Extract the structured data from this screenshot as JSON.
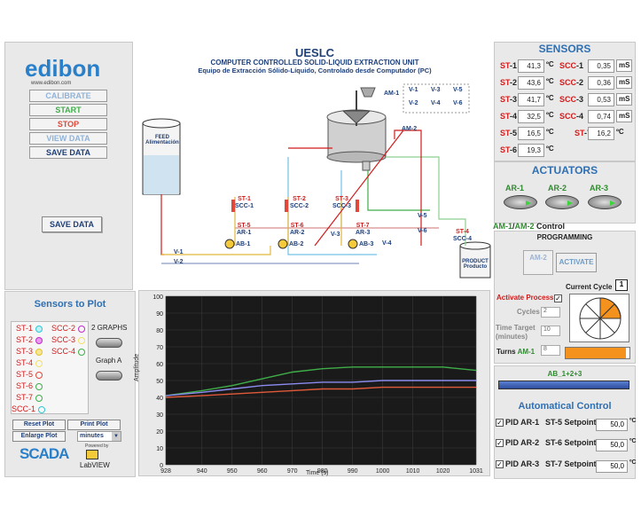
{
  "brand": {
    "logo": "edibon",
    "url": "www.edibon.com"
  },
  "left_buttons": {
    "calibrate": "CALIBRATE",
    "start": "START",
    "stop": "STOP",
    "view_data": "VIEW DATA",
    "save_data": "SAVE DATA",
    "save_data_2": "SAVE DATA"
  },
  "diagram": {
    "title": "UESLC",
    "subtitle": "COMPUTER CONTROLLED SOLID-LIQUID EXTRACTION UNIT",
    "subtitle2": "Equipo de Extracción Sólido-Líquido, Controlado desde Computador (PC)",
    "feed_tank": "FEED Alimentación",
    "product_tank": "PRODUCT Producto",
    "am1": "AM-1",
    "am2": "AM-2",
    "v1": "V-1",
    "v2": "V-2",
    "v3": "V-3",
    "v4": "V-4",
    "v5": "V-5",
    "v6": "V-6",
    "st1": "ST-1",
    "scc1": "SCC-1",
    "st2": "ST-2",
    "scc2": "SCC-2",
    "st3": "ST-3",
    "scc3": "SCC-3",
    "st4": "ST-4",
    "scc4": "SCC-4",
    "st5": "ST-5",
    "ar1": "AR-1",
    "st6": "ST-6",
    "ar2": "AR-2",
    "st7": "ST-7",
    "ar3": "AR-3",
    "ab1": "AB-1",
    "ab2": "AB-2",
    "ab3": "AB-3"
  },
  "sensors": {
    "title": "SENSORS",
    "st1": {
      "pre": "ST",
      "num": "-1",
      "value": "41,3",
      "unit": "ºC"
    },
    "st2": {
      "pre": "ST",
      "num": "-2",
      "value": "43,6",
      "unit": "ºC"
    },
    "st3": {
      "pre": "ST",
      "num": "-3",
      "value": "41,7",
      "unit": "ºC"
    },
    "st4": {
      "pre": "ST",
      "num": "-4",
      "value": "32,5",
      "unit": "ºC"
    },
    "st5": {
      "pre": "ST",
      "num": "-5",
      "value": "16,5",
      "unit": "ºC"
    },
    "st6": {
      "pre": "ST",
      "num": "-6",
      "value": "19,3",
      "unit": "ºC"
    },
    "st7": {
      "pre": "ST",
      "num": "-7",
      "value": "16,2",
      "unit": "ºC"
    },
    "scc1": {
      "pre": "SCC",
      "num": "-1",
      "value": "0,35",
      "unit": "mS"
    },
    "scc2": {
      "pre": "SCC",
      "num": "-2",
      "value": "0,36",
      "unit": "mS"
    },
    "scc3": {
      "pre": "SCC",
      "num": "-3",
      "value": "0,53",
      "unit": "mS"
    },
    "scc4": {
      "pre": "SCC",
      "num": "-4",
      "value": "0,74",
      "unit": "mS"
    }
  },
  "actuators": {
    "title": "ACTUATORS",
    "ar1": "AR-1",
    "ar2": "AR-2",
    "ar3": "AR-3",
    "am_control_am1": "AM-1",
    "am_control_sep": "/",
    "am_control_am2": "AM-2",
    "am_control_suffix": " Control",
    "programming": "PROGRAMMING",
    "am2_switch": "AM-2",
    "activate": "ACTIVATE",
    "current_cycle_label": "Current Cycle",
    "current_cycle_value": "1",
    "activate_process": "Activate Process",
    "cycles_label": "Cycles",
    "cycles_value": "2",
    "time_target_label": "Time Target (minutes)",
    "time_target_value": "10",
    "turns_label": "Turns ",
    "turns_am": "AM-1",
    "turns_value": "8",
    "turns_progress": 0.95
  },
  "ab_control": {
    "label": "AB_1+2+3",
    "title": "Automatical Control",
    "rows": [
      {
        "pid": "PID AR-1",
        "setpoint": "ST-5 Setpoint",
        "value": "50,0",
        "unit": "ºC"
      },
      {
        "pid": "PID AR-2",
        "setpoint": "ST-6 Setpoint",
        "value": "50,0",
        "unit": "ºC"
      },
      {
        "pid": "PID AR-3",
        "setpoint": "ST-7 Setpoint",
        "value": "50,0",
        "unit": "ºC"
      }
    ]
  },
  "sensors_to_plot": {
    "title": "Sensors to Plot",
    "left": [
      "ST-1",
      "ST-2",
      "ST-3",
      "ST-4",
      "ST-5",
      "ST-6",
      "ST-7",
      "SCC-1"
    ],
    "right": [
      "SCC-2",
      "SCC-3",
      "SCC-4"
    ],
    "two_graphs": "2 GRAPHS",
    "graph_a": "Graph A",
    "reset_plot": "Reset Plot",
    "print_plot": "Print Plot",
    "enlarge_plot": "Enlarge Plot",
    "time_unit": "minutes"
  },
  "footer": {
    "scada": "SCADA",
    "powered": "Powered by",
    "labview": "LabVIEW"
  },
  "colors": {
    "plot_bg": "#1a1a1a",
    "series_green": "#3fae49",
    "series_blue": "#7a7ae0",
    "series_red": "#e05a3a"
  },
  "chart_data": {
    "type": "line",
    "xlabel": "Time (s)",
    "ylabel": "Amplitude",
    "xlim": [
      928,
      1031
    ],
    "ylim": [
      0,
      100
    ],
    "x_ticks": [
      928,
      940,
      950,
      960,
      970,
      980,
      990,
      1000,
      1010,
      1020,
      1031
    ],
    "y_ticks": [
      0,
      10,
      20,
      30,
      40,
      50,
      60,
      70,
      80,
      90,
      100
    ],
    "x": [
      928,
      940,
      950,
      960,
      970,
      980,
      990,
      1000,
      1010,
      1020,
      1031
    ],
    "series": [
      {
        "color": "#3fae49",
        "values": [
          41,
          44,
          47,
          51,
          55,
          57,
          58,
          58,
          58,
          58,
          56
        ]
      },
      {
        "color": "#8c8cf0",
        "values": [
          41,
          43,
          45,
          47,
          48,
          49,
          49,
          50,
          50,
          50,
          50
        ]
      },
      {
        "color": "#e05a3a",
        "values": [
          40,
          41,
          42,
          43,
          44,
          45,
          45,
          46,
          46,
          46,
          46
        ]
      }
    ]
  }
}
